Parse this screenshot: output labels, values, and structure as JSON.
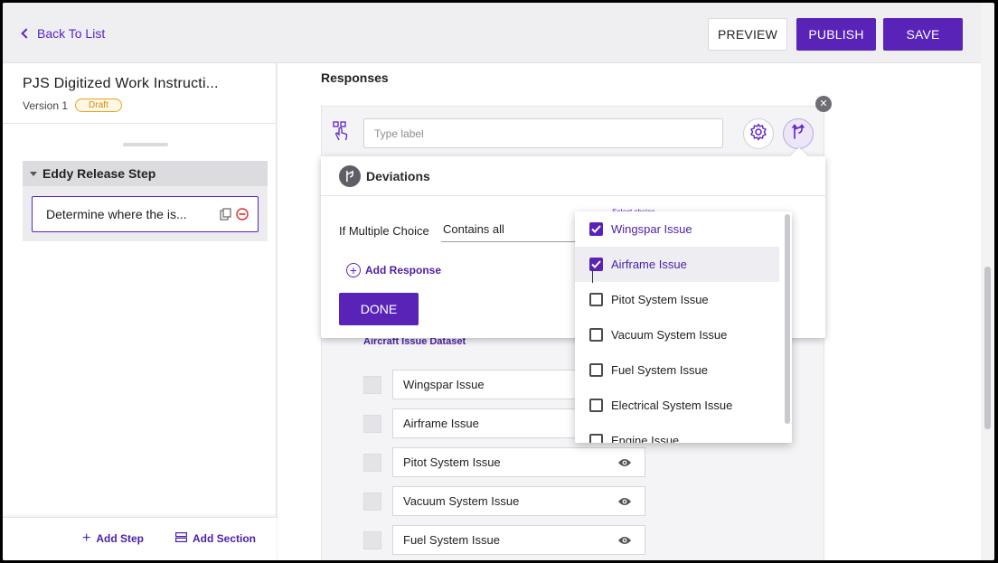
{
  "header": {
    "back_label": "Back To List",
    "preview_label": "PREVIEW",
    "publish_label": "PUBLISH",
    "save_label": "SAVE"
  },
  "sidebar": {
    "doc_title": "PJS Digitized Work Instructi...",
    "version": "Version 1",
    "status_badge": "Draft",
    "section_title": "Eddy Release Step",
    "step_label": "Determine where the is...",
    "add_step_label": "Add Step",
    "add_section_label": "Add Section"
  },
  "main": {
    "responses_title": "Responses",
    "type_label_placeholder": "Type label",
    "dataset_title": "Aircraft Issue Dataset",
    "options": [
      {
        "label": "Wingspar Issue"
      },
      {
        "label": "Airframe Issue"
      },
      {
        "label": "Pitot System Issue"
      },
      {
        "label": "Vacuum System Issue"
      },
      {
        "label": "Fuel System Issue"
      }
    ]
  },
  "deviations": {
    "title": "Deviations",
    "condition_label": "If Multiple Choice",
    "condition_value": "Contains all",
    "select_choice_label": "Select choice",
    "add_response_label": "Add Response",
    "done_label": "DONE"
  },
  "dropdown": {
    "items": [
      {
        "label": "Wingspar Issue",
        "checked": true
      },
      {
        "label": "Airframe Issue",
        "checked": true
      },
      {
        "label": "Pitot System Issue",
        "checked": false
      },
      {
        "label": "Vacuum System Issue",
        "checked": false
      },
      {
        "label": "Fuel System Issue",
        "checked": false
      },
      {
        "label": "Electrical System Issue",
        "checked": false
      },
      {
        "label": "Engine Issue",
        "checked": false
      }
    ]
  },
  "colors": {
    "accent": "#5923b8",
    "draft": "#e7a31b"
  }
}
